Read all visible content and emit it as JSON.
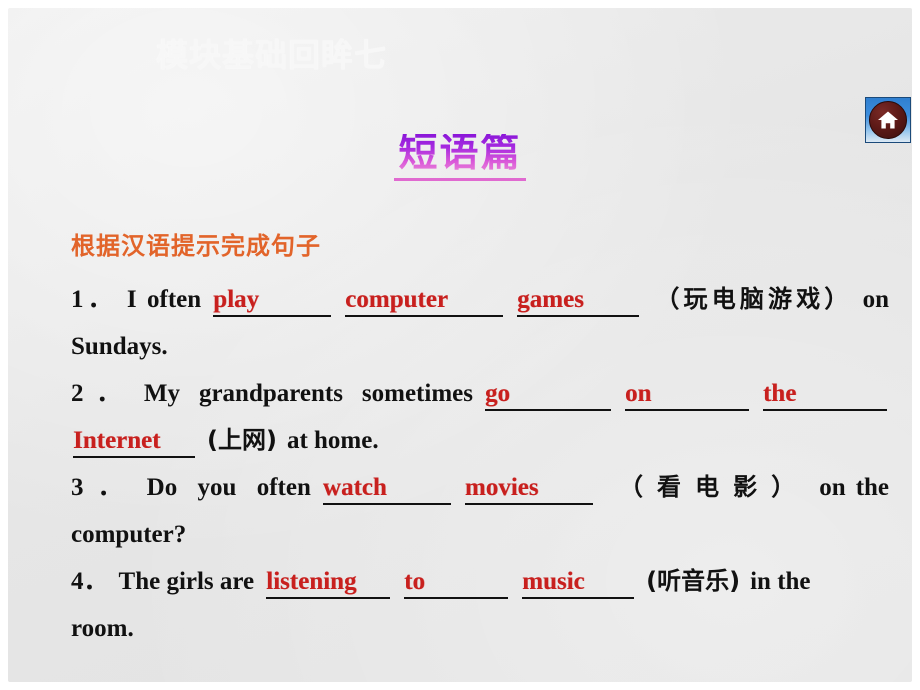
{
  "slide": {
    "module_title": "模块基础回眸七",
    "section_heading": "短语篇",
    "instruction": "根据汉语提示完成句子",
    "home_icon": "home-icon",
    "colors": {
      "background": "#e8e8e8",
      "module_title": "#f7f7f7",
      "section_heading_from": "#8a16d8",
      "section_heading_to": "#f09ad8",
      "section_underline": "#e06ad0",
      "instruction": "#e2642a",
      "body_text": "#111111",
      "answer": "#c8201e",
      "home_badge": "#3d8ede"
    }
  },
  "exercise": {
    "questions": [
      {
        "number": "1．",
        "parts": [
          {
            "type": "text",
            "value": "I often"
          },
          {
            "type": "blank",
            "value": "play",
            "key": "play"
          },
          {
            "type": "blank",
            "value": "computer",
            "key": "computer"
          },
          {
            "type": "blank",
            "value": "games",
            "key": "games"
          },
          {
            "type": "cn",
            "value": "（玩电脑游戏）"
          },
          {
            "type": "text",
            "value": "on"
          },
          {
            "type": "text",
            "value": "Sundays."
          }
        ]
      },
      {
        "number": "2．",
        "parts": [
          {
            "type": "text",
            "value": "My grandparents sometimes"
          },
          {
            "type": "blank",
            "value": "go",
            "key": "go"
          },
          {
            "type": "blank",
            "value": "on",
            "key": "on"
          },
          {
            "type": "blank",
            "value": "the",
            "key": "the"
          },
          {
            "type": "blank",
            "value": "Internet",
            "key": "internet"
          },
          {
            "type": "cn",
            "value": "(上网)"
          },
          {
            "type": "text",
            "value": "at home."
          }
        ]
      },
      {
        "number": "3．",
        "parts": [
          {
            "type": "text",
            "value": "Do you often"
          },
          {
            "type": "blank",
            "value": "watch",
            "key": "watch"
          },
          {
            "type": "blank",
            "value": "movies",
            "key": "movies"
          },
          {
            "type": "cn",
            "value": "（看电影）"
          },
          {
            "type": "text",
            "value": "on the"
          },
          {
            "type": "text",
            "value": "computer?"
          }
        ]
      },
      {
        "number": "4．",
        "parts": [
          {
            "type": "text",
            "value": "The girls are"
          },
          {
            "type": "blank",
            "value": "listening",
            "key": "listening"
          },
          {
            "type": "blank",
            "value": "to",
            "key": "to"
          },
          {
            "type": "blank",
            "value": "music",
            "key": "music"
          },
          {
            "type": "cn",
            "value": "(听音乐)"
          },
          {
            "type": "text",
            "value": "in the"
          },
          {
            "type": "text",
            "value": "room."
          }
        ]
      }
    ],
    "lines": {
      "q1a_num": "1．",
      "q1a_t1": "I  often",
      "q1a_play": "play",
      "q1a_computer": "computer",
      "q1a_games": "games",
      "q1a_cn": "（玩电脑游戏）",
      "q1a_on": "on",
      "q1b": "Sundays.",
      "q2a_num": "2．",
      "q2a_t1": "My grandparents sometimes",
      "q2a_go": "go",
      "q2a_on": "on",
      "q2a_the": "the",
      "q2b_internet": "Internet",
      "q2b_cn": "(上网)",
      "q2b_t": "at home.",
      "q3a_num": "3．",
      "q3a_t1": "Do   you   often",
      "q3a_watch": "watch",
      "q3a_movies": "movies",
      "q3a_cn": "（看电影）",
      "q3a_t2": "on",
      "q3a_t3": "the",
      "q3b": "computer?",
      "q4a_num": "4．",
      "q4a_t1": "The girls are",
      "q4a_listening": "listening",
      "q4a_to": "to",
      "q4a_music": "music",
      "q4a_cn": "(听音乐)",
      "q4a_t2": "in the",
      "q4b": "room."
    }
  }
}
